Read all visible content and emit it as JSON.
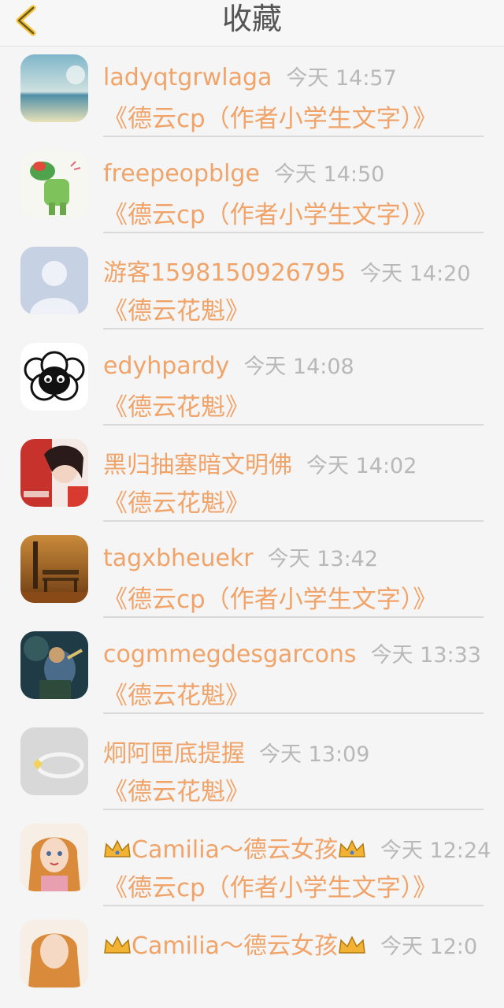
{
  "header": {
    "title": "收藏",
    "back_icon": "chevron-left-icon"
  },
  "items": [
    {
      "name": "ladyqtgrwlaga",
      "time": "今天 14:57",
      "title": "《德云cp（作者小学生文字）》"
    },
    {
      "name": "freepeopblge",
      "time": "今天 14:50",
      "title": "《德云cp（作者小学生文字）》"
    },
    {
      "name": "游客1598150926795",
      "time": "今天 14:20",
      "title": "《德云花魁》"
    },
    {
      "name": "edyhpardy",
      "time": "今天 14:08",
      "title": "《德云花魁》"
    },
    {
      "name": "黑归抽塞暗文明佛",
      "time": "今天 14:02",
      "title": "《德云花魁》"
    },
    {
      "name": "tagxbheuekr",
      "time": "今天 13:42",
      "title": "《德云cp（作者小学生文字）》"
    },
    {
      "name": "cogmmegdesgarcons",
      "time": "今天 13:33",
      "title": "《德云花魁》"
    },
    {
      "name": "炯阿匣底提握",
      "time": "今天 13:09",
      "title": "《德云花魁》"
    },
    {
      "name": "Camilia～德云女孩",
      "time": "今天 12:24",
      "title": "《德云cp（作者小学生文字）》"
    },
    {
      "name": "Camilia～德云女孩",
      "time": "今天 12:0",
      "title": ""
    }
  ],
  "colors": {
    "accent": "#f0a46a",
    "time": "#b8b8b8",
    "back": "#f0c23a"
  }
}
